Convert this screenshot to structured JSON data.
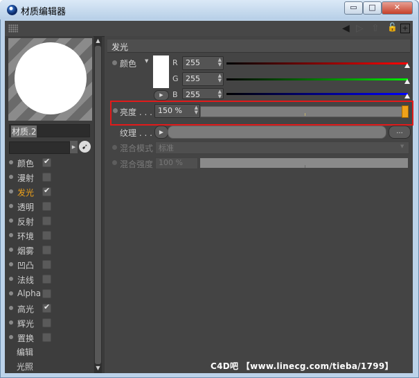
{
  "window": {
    "title": "材质编辑器",
    "minimize_label": "▭",
    "maximize_label": "□",
    "close_label": "✕"
  },
  "toolbar": {
    "back_icon": "◀",
    "forward_icon": "▷",
    "up_icon": "⇧",
    "lock_icon": "🔓",
    "new_icon": "+"
  },
  "material": {
    "name": "材质.2"
  },
  "channels": [
    {
      "label": "颜色",
      "checked": true
    },
    {
      "label": "漫射",
      "checked": false
    },
    {
      "label": "发光",
      "checked": true,
      "active": true
    },
    {
      "label": "透明",
      "checked": false
    },
    {
      "label": "反射",
      "checked": false
    },
    {
      "label": "环境",
      "checked": false
    },
    {
      "label": "烟雾",
      "checked": false
    },
    {
      "label": "凹凸",
      "checked": false
    },
    {
      "label": "法线",
      "checked": false
    },
    {
      "label": "Alpha",
      "checked": false
    },
    {
      "label": "高光",
      "checked": true
    },
    {
      "label": "辉光",
      "checked": false
    },
    {
      "label": "置换",
      "checked": false
    }
  ],
  "extra_items": [
    "编辑",
    "光照"
  ],
  "section": {
    "title": "发光"
  },
  "color": {
    "label": "颜色",
    "r_label": "R",
    "r_value": "255",
    "g_label": "G",
    "g_value": "255",
    "b_label": "B",
    "b_value": "255",
    "swatch_hex": "#ffffff"
  },
  "brightness": {
    "label": "亮度 . . .",
    "value": "150 %",
    "level_fraction": 1.0
  },
  "texture": {
    "label": "纹理 . . .",
    "more_label": "..."
  },
  "mix_mode": {
    "label": "混合模式",
    "value": "标准"
  },
  "mix_strength": {
    "label": "混合强度",
    "value": "100 %"
  },
  "watermark": "C4D吧 【www.linecg.com/tieba/1799】",
  "colors": {
    "accent": "#f0a21a",
    "highlight_box": "#e21a1a",
    "panel": "#444444"
  }
}
